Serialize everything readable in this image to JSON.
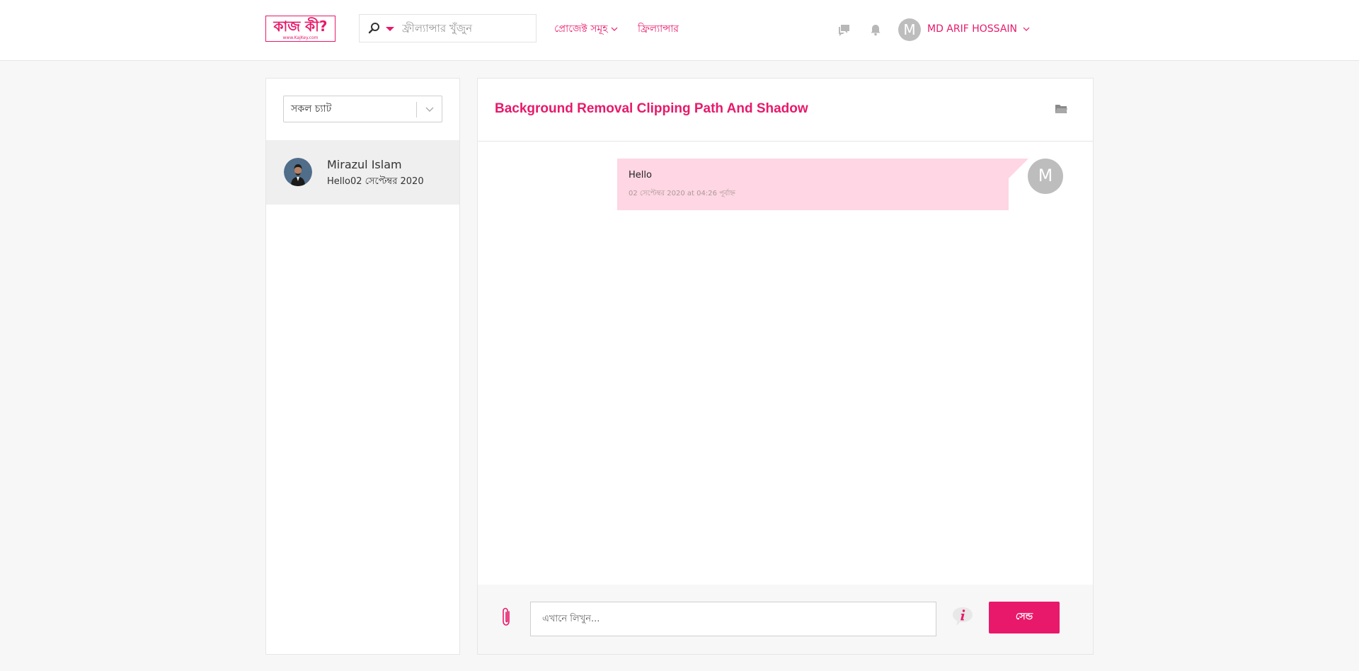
{
  "brand": {
    "logo_text": "কাজ কী?",
    "logo_url_text": "www.KajKey.com",
    "accent_color": "#e8196a"
  },
  "header": {
    "search": {
      "placeholder": "ফ্রীল্যান্সার খুঁজুন",
      "icon": "search-icon"
    },
    "nav": [
      {
        "label": "প্রোজেক্ট সমূহ",
        "has_dropdown": true
      },
      {
        "label": "ফ্রিল্যান্সার",
        "has_dropdown": false
      }
    ],
    "icons": [
      "messages-icon",
      "bell-icon"
    ],
    "user": {
      "initial": "M",
      "name": "MD ARIF HOSSAIN"
    }
  },
  "sidebar": {
    "filter": {
      "selected": "সকল চ্যাট"
    },
    "chats": [
      {
        "name": "Mirazul Islam",
        "preview": "Hello02 সেপ্টেম্বর 2020",
        "active": true
      }
    ]
  },
  "conversation": {
    "title": "Background Removal Clipping Path And Shadow",
    "messages": [
      {
        "text": "Hello",
        "timestamp": "02 সেপ্টেম্বর 2020 at 04:26 পূর্বাহ্ন",
        "sender_initial": "M"
      }
    ],
    "composer": {
      "placeholder": "এখানে লিখুন...",
      "send_label": "সেন্ড"
    }
  }
}
